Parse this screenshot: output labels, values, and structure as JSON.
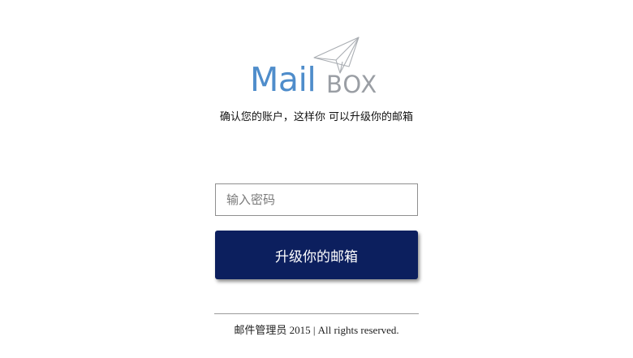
{
  "logo": {
    "mail_text": "Mail",
    "box_text": "BOX",
    "icon": "paper-plane-icon",
    "mail_color": "#4f8dcb",
    "box_color": "#9a9ea4"
  },
  "subtitle": "确认您的账户，这样你 可以升级你的邮箱",
  "password_input": {
    "value": "",
    "placeholder": "输入密码"
  },
  "upgrade_button": {
    "label": "升级你的邮箱",
    "background": "#0c1f5e"
  },
  "footer": {
    "text": "邮件管理员 2015 | All rights reserved."
  }
}
